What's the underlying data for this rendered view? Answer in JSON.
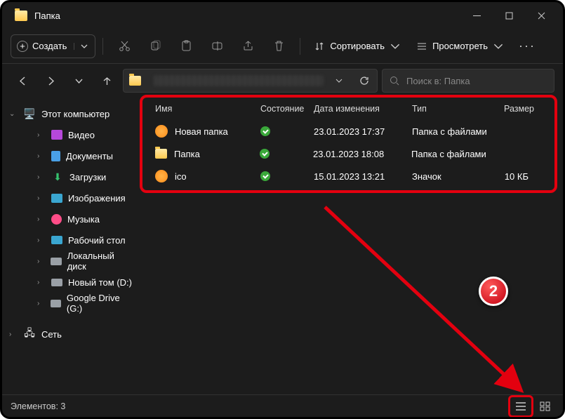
{
  "window": {
    "title": "Папка"
  },
  "toolbar": {
    "new_label": "Создать",
    "sort_label": "Сортировать",
    "view_label": "Просмотреть"
  },
  "search": {
    "placeholder": "Поиск в: Папка"
  },
  "columns": {
    "name": "Имя",
    "status": "Состояние",
    "modified": "Дата изменения",
    "type": "Тип",
    "size": "Размер"
  },
  "rows": [
    {
      "name": "Новая папка",
      "modified": "23.01.2023 17:37",
      "type": "Папка с файлами",
      "size": "",
      "icon": "orange"
    },
    {
      "name": "Папка",
      "modified": "23.01.2023 18:08",
      "type": "Папка с файлами",
      "size": "",
      "icon": "folder"
    },
    {
      "name": "ico",
      "modified": "15.01.2023 13:21",
      "type": "Значок",
      "size": "10 КБ",
      "icon": "orange"
    }
  ],
  "sidebar": {
    "root": "Этот компьютер",
    "items": [
      {
        "label": "Видео",
        "color": "#b648d9"
      },
      {
        "label": "Документы",
        "color": "#4aa0e6"
      },
      {
        "label": "Загрузки",
        "color": "#36c26e"
      },
      {
        "label": "Изображения",
        "color": "#3aa6d0"
      },
      {
        "label": "Музыка",
        "color": "#ff4d88"
      },
      {
        "label": "Рабочий стол",
        "color": "#3aa6d0"
      },
      {
        "label": "Локальный диск",
        "color": "#9aa0a6"
      },
      {
        "label": "Новый том (D:)",
        "color": "#9aa0a6"
      },
      {
        "label": "Google Drive (G:)",
        "color": "#9aa0a6"
      }
    ],
    "network": "Сеть"
  },
  "statusbar": {
    "count_label": "Элементов: 3"
  },
  "callout": {
    "number": "2"
  }
}
